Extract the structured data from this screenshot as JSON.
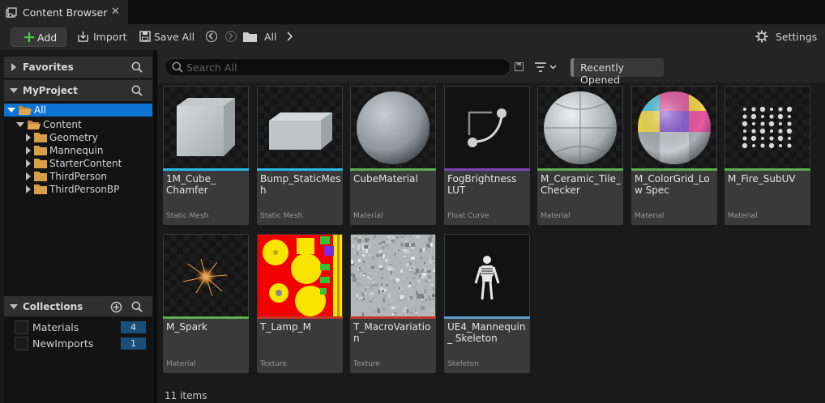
{
  "tab": {
    "title": "Content Browser",
    "close": "✕"
  },
  "toolbar": {
    "add_label": "Add",
    "import_label": "Import",
    "save_all_label": "Save All",
    "path_label": "All",
    "settings_label": "Settings"
  },
  "sidebar": {
    "favorites_label": "Favorites",
    "project_label": "MyProject",
    "tree": {
      "all": "All",
      "content": "Content",
      "folders": [
        "Geometry",
        "Mannequin",
        "StarterContent",
        "ThirdPerson",
        "ThirdPersonBP"
      ]
    },
    "collections_label": "Collections",
    "collections": [
      {
        "name": "Materials",
        "count": "4"
      },
      {
        "name": "NewImports",
        "count": "1"
      }
    ]
  },
  "search": {
    "placeholder": "Search All"
  },
  "filter_chip": "Recently Opened",
  "assets": [
    {
      "name": "1M_Cube_ Chamfer",
      "type": "Static Mesh",
      "color": "#29b8e6",
      "icon": "cube-mesh"
    },
    {
      "name": "Bump_StaticMesh",
      "type": "Static Mesh",
      "color": "#29b8e6",
      "icon": "box-mesh"
    },
    {
      "name": "CubeMaterial",
      "type": "Material",
      "color": "#5ab04a",
      "icon": "gray-sphere"
    },
    {
      "name": "FogBrightness LUT",
      "type": "Float Curve",
      "color": "#7a46b4",
      "icon": "curve"
    },
    {
      "name": "M_Ceramic_Tile_ Checker",
      "type": "Material",
      "color": "#5ab04a",
      "icon": "tile-sphere"
    },
    {
      "name": "M_ColorGrid_Low Spec",
      "type": "Material",
      "color": "#5ab04a",
      "icon": "colorgrid-sphere"
    },
    {
      "name": "M_Fire_SubUV",
      "type": "Material",
      "color": "#5ab04a",
      "icon": "fire-sheet"
    },
    {
      "name": "M_Spark",
      "type": "Material",
      "color": "#5ab04a",
      "icon": "spark"
    },
    {
      "name": "T_Lamp_M",
      "type": "Texture",
      "color": "#c0392b",
      "icon": "lamp-texture"
    },
    {
      "name": "T_MacroVariation",
      "type": "Texture",
      "color": "#c0392b",
      "icon": "noise-texture"
    },
    {
      "name": "UE4_Mannequin_ Skeleton",
      "type": "Skeleton",
      "color": "#5a9ecf",
      "icon": "skeleton"
    }
  ],
  "status": "11 items"
}
